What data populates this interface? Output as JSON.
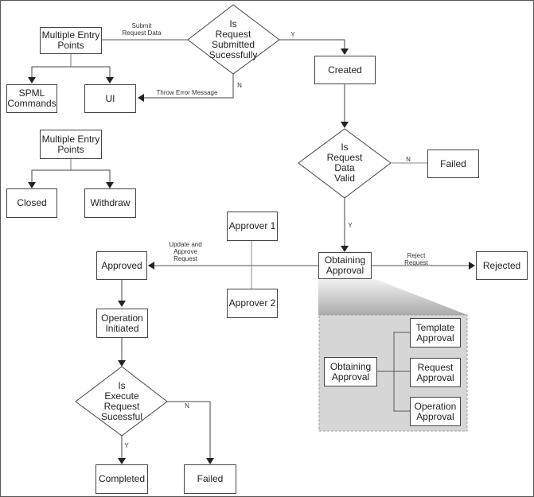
{
  "nodes": {
    "entry_points_1": "Multiple Entry\nPoints",
    "spml_commands": "SPML\nCommands",
    "ui": "UI",
    "entry_points_2": "Multiple Entry\nPoints",
    "closed": "Closed",
    "withdraw": "Withdraw",
    "decision_submitted": "Is\nRequest\nSubmitted\nSucessfully",
    "created": "Created",
    "decision_valid": "Is\nRequest\nData\nValid",
    "failed_validation": "Failed",
    "approver_1": "Approver 1",
    "approver_2": "Approver 2",
    "approved": "Approved",
    "obtaining_approval": "Obtaining\nApproval",
    "rejected": "Rejected",
    "operation_initiated": "Operation\nInitiated",
    "decision_execute": "Is\nExecute\nRequest\nSucessful",
    "completed": "Completed",
    "failed_execution": "Failed",
    "detail_obtaining_approval": "Obtaining\nApproval",
    "template_approval": "Template\nApproval",
    "request_approval": "Request\nApproval",
    "operation_approval": "Operation\nApproval"
  },
  "edge_labels": {
    "submit_request_data": "Submit\nRequest Data",
    "throw_error_message": "Throw Error Message",
    "submitted_yes": "Y",
    "submitted_no": "N",
    "valid_no": "N",
    "valid_yes": "Y",
    "update_and_approve": "Update and\nApprove\nRequest",
    "reject_request": "Reject\nRequest",
    "execute_no": "N",
    "execute_yes": "Y"
  }
}
